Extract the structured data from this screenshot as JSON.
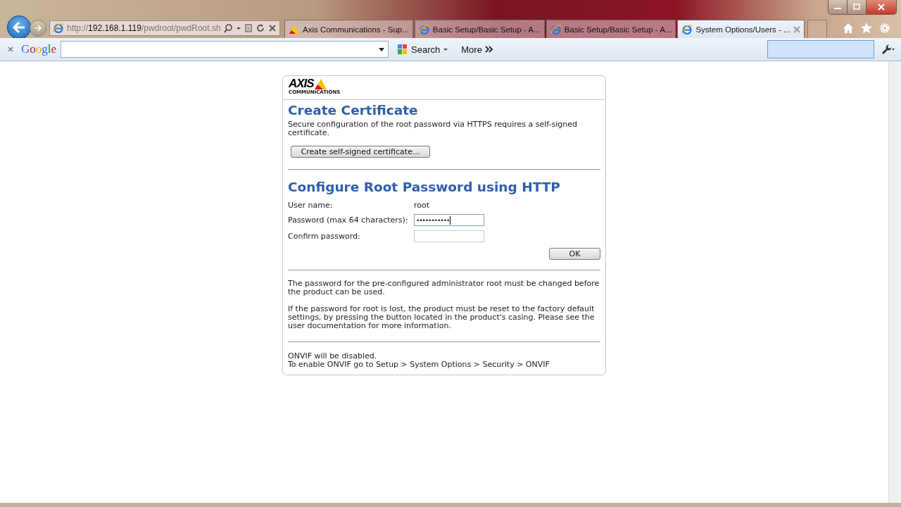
{
  "browser": {
    "address": {
      "prefix": "http://",
      "host": "192.168.1.119",
      "path": "/pwdroot/pwdRoot.sh"
    },
    "tabs": [
      {
        "title": "Axis Communications - Sup...",
        "kind": "axis",
        "selected": false
      },
      {
        "title": "Basic Setup/Basic Setup - A...",
        "kind": "ie",
        "selected": false
      },
      {
        "title": "Basic Setup/Basic Setup - A...",
        "kind": "ie",
        "selected": false
      },
      {
        "title": "System Options/Users - ...",
        "kind": "ie",
        "selected": true
      }
    ],
    "toolbar": {
      "brand": "Google",
      "search_button": "Search",
      "more_button": "More"
    }
  },
  "page": {
    "logo": {
      "name": "AXIS",
      "sub": "COMMUNICATIONS"
    },
    "certificate": {
      "heading": "Create Certificate",
      "text": "Secure configuration of the root password via HTTPS requires a self-signed certificate.",
      "button": "Create self-signed certificate..."
    },
    "password": {
      "heading": "Configure Root Password using HTTP",
      "fields": [
        {
          "kind": "text",
          "label": "User name:",
          "value": "root"
        },
        {
          "kind": "input",
          "label": "Password (max 64 characters):",
          "value": "•••••••••••",
          "focused": true
        },
        {
          "kind": "input",
          "label": "Confirm password:",
          "focused": false
        }
      ],
      "button": "OK"
    },
    "notes": [
      "The password for the pre-configured administrator root must be changed before the product can be used.",
      "If the password for root is lost, the product must be reset to the factory default settings, by pressing the button located in the product's casing. Please see the user documentation for more information."
    ],
    "onvif": [
      "ONVIF will be disabled.",
      "To enable ONVIF go to Setup > System Options > Security > ONVIF"
    ]
  }
}
